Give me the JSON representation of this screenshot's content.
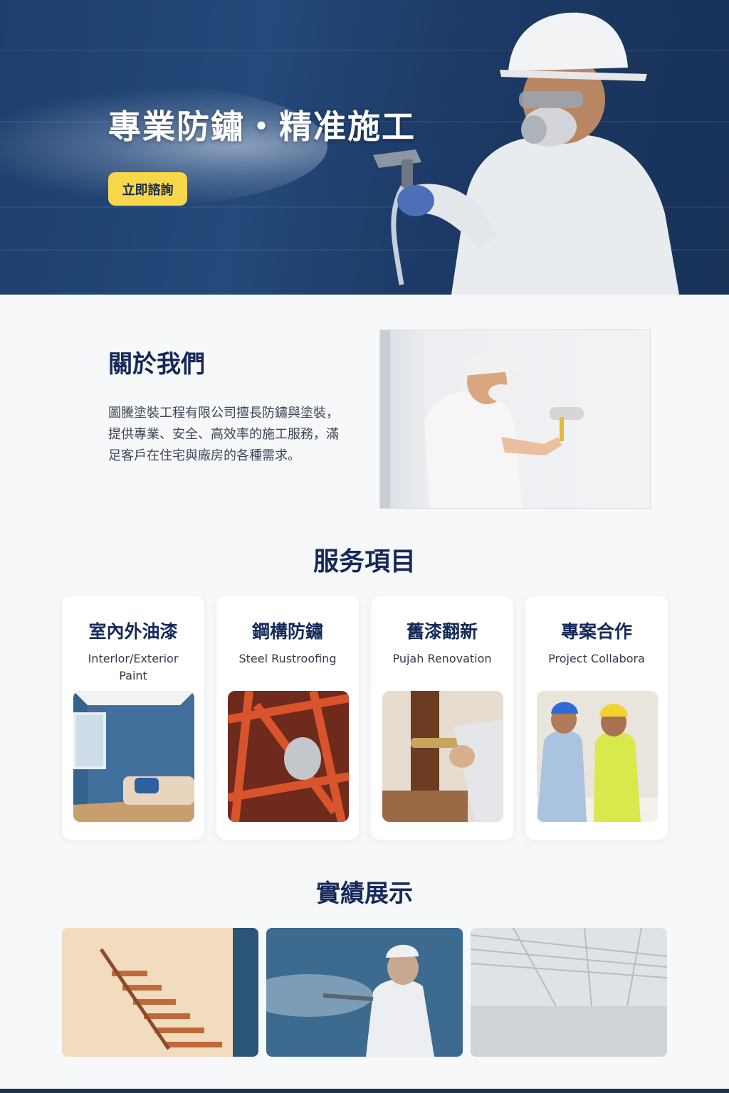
{
  "hero": {
    "title": "專業防鏽・精准施工",
    "cta_label": "立即諮詢"
  },
  "about": {
    "title": "關於我們",
    "body": "圖騰塗裝工程有限公司擅長防鏽與塗裝，提供專業、安全、高效率的施工服務，滿足客戶在住宅與廠房的各種需求。"
  },
  "services": {
    "title": "服务項目",
    "items": [
      {
        "title": "室內外油漆",
        "subtitle": "Interlor/Exterior\nPaint"
      },
      {
        "title": "鋼構防鏽",
        "subtitle": "Steel Rustroofing"
      },
      {
        "title": "舊漆翻新",
        "subtitle": "Pujah Renovation"
      },
      {
        "title": "專案合作",
        "subtitle": "Project Collabora"
      }
    ]
  },
  "portfolio": {
    "title": "實績展示"
  },
  "colors": {
    "brand_navy": "#16295a",
    "accent_yellow": "#f7d84b",
    "hero_blue": "#24497a"
  }
}
